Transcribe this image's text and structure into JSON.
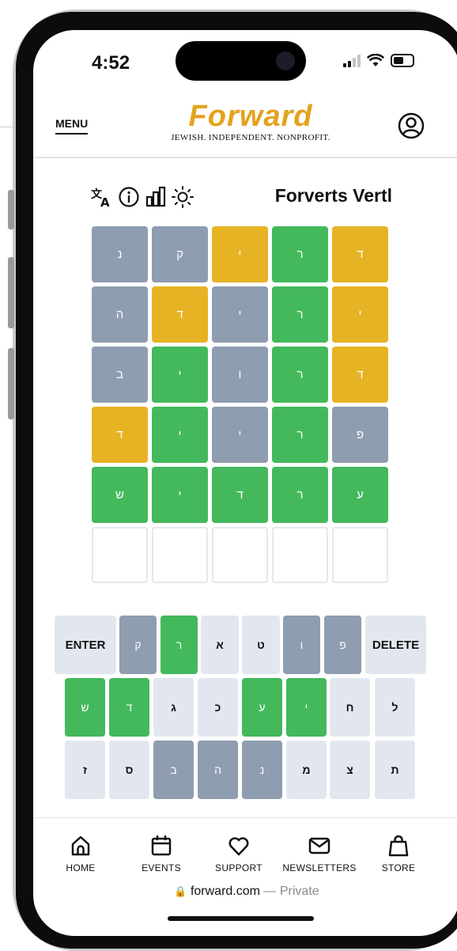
{
  "status_bar": {
    "time": "4:52"
  },
  "header": {
    "menu_label": "MENU",
    "logo_text": "Forward",
    "tagline": "JEWISH. INDEPENDENT. NONPROFIT.",
    "accent_color": "#e3a31e"
  },
  "toolbar": {
    "icons": [
      "translate-icon",
      "info-icon",
      "stats-icon",
      "theme-icon"
    ],
    "game_title": "Forverts Vertl"
  },
  "board": {
    "rows": [
      [
        {
          "letter": "נ",
          "state": "gray"
        },
        {
          "letter": "ק",
          "state": "gray"
        },
        {
          "letter": "י",
          "state": "yellow"
        },
        {
          "letter": "ר",
          "state": "green"
        },
        {
          "letter": "ד",
          "state": "yellow"
        }
      ],
      [
        {
          "letter": "ה",
          "state": "gray"
        },
        {
          "letter": "ד",
          "state": "yellow"
        },
        {
          "letter": "י",
          "state": "gray"
        },
        {
          "letter": "ר",
          "state": "green"
        },
        {
          "letter": "י",
          "state": "yellow"
        }
      ],
      [
        {
          "letter": "ב",
          "state": "gray"
        },
        {
          "letter": "י",
          "state": "green"
        },
        {
          "letter": "ו",
          "state": "gray"
        },
        {
          "letter": "ר",
          "state": "green"
        },
        {
          "letter": "ד",
          "state": "yellow"
        }
      ],
      [
        {
          "letter": "ד",
          "state": "yellow"
        },
        {
          "letter": "י",
          "state": "green"
        },
        {
          "letter": "י",
          "state": "gray"
        },
        {
          "letter": "ר",
          "state": "green"
        },
        {
          "letter": "פ",
          "state": "gray"
        }
      ],
      [
        {
          "letter": "ש",
          "state": "green"
        },
        {
          "letter": "י",
          "state": "green"
        },
        {
          "letter": "ד",
          "state": "green"
        },
        {
          "letter": "ר",
          "state": "green"
        },
        {
          "letter": "ע",
          "state": "green"
        }
      ],
      [
        {
          "letter": "",
          "state": "empty"
        },
        {
          "letter": "",
          "state": "empty"
        },
        {
          "letter": "",
          "state": "empty"
        },
        {
          "letter": "",
          "state": "empty"
        },
        {
          "letter": "",
          "state": "empty"
        }
      ]
    ],
    "colors": {
      "gray": "#8f9db0",
      "yellow": "#e6b325",
      "green": "#43b95c"
    }
  },
  "keyboard": {
    "rows": [
      [
        {
          "label": "ENTER",
          "state": "default",
          "wide": true
        },
        {
          "label": "ק",
          "state": "gray"
        },
        {
          "label": "ר",
          "state": "green"
        },
        {
          "label": "א",
          "state": "default"
        },
        {
          "label": "ט",
          "state": "default"
        },
        {
          "label": "ו",
          "state": "gray"
        },
        {
          "label": "פ",
          "state": "gray"
        },
        {
          "label": "DELETE",
          "state": "default",
          "wide": true
        }
      ],
      [
        {
          "label": "ש",
          "state": "green"
        },
        {
          "label": "ד",
          "state": "green"
        },
        {
          "label": "ג",
          "state": "default"
        },
        {
          "label": "כ",
          "state": "default"
        },
        {
          "label": "ע",
          "state": "green"
        },
        {
          "label": "י",
          "state": "green"
        },
        {
          "label": "ח",
          "state": "default"
        },
        {
          "label": "ל",
          "state": "default"
        }
      ],
      [
        {
          "label": "ז",
          "state": "default"
        },
        {
          "label": "ס",
          "state": "default"
        },
        {
          "label": "ב",
          "state": "gray"
        },
        {
          "label": "ה",
          "state": "gray"
        },
        {
          "label": "נ",
          "state": "gray"
        },
        {
          "label": "מ",
          "state": "default"
        },
        {
          "label": "צ",
          "state": "default"
        },
        {
          "label": "ת",
          "state": "default"
        }
      ]
    ]
  },
  "bottom_nav": {
    "items": [
      {
        "label": "HOME",
        "icon": "home-icon"
      },
      {
        "label": "EVENTS",
        "icon": "calendar-icon"
      },
      {
        "label": "SUPPORT",
        "icon": "heart-icon"
      },
      {
        "label": "NEWSLETTERS",
        "icon": "mail-icon"
      },
      {
        "label": "STORE",
        "icon": "shopping-bag-icon"
      }
    ]
  },
  "url_bar": {
    "domain": "forward.com",
    "separator": " — ",
    "mode": "Private"
  }
}
